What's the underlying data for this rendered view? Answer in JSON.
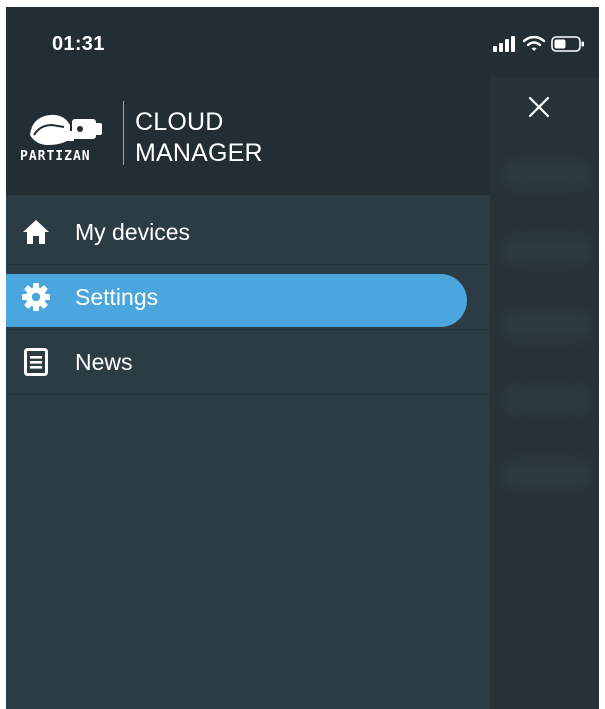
{
  "status_bar": {
    "time": "01:31"
  },
  "header": {
    "brand": "PARTIZAN",
    "title_line1": "CLOUD",
    "title_line2": "MANAGER"
  },
  "menu": {
    "items": [
      {
        "label": "My devices",
        "icon": "home-icon",
        "active": false
      },
      {
        "label": "Settings",
        "icon": "gear-icon",
        "active": true
      },
      {
        "label": "News",
        "icon": "news-icon",
        "active": false
      }
    ]
  },
  "colors": {
    "active_bg": "#4aa6dd",
    "drawer_bg": "#2c3c45",
    "header_bg": "#232d34"
  }
}
